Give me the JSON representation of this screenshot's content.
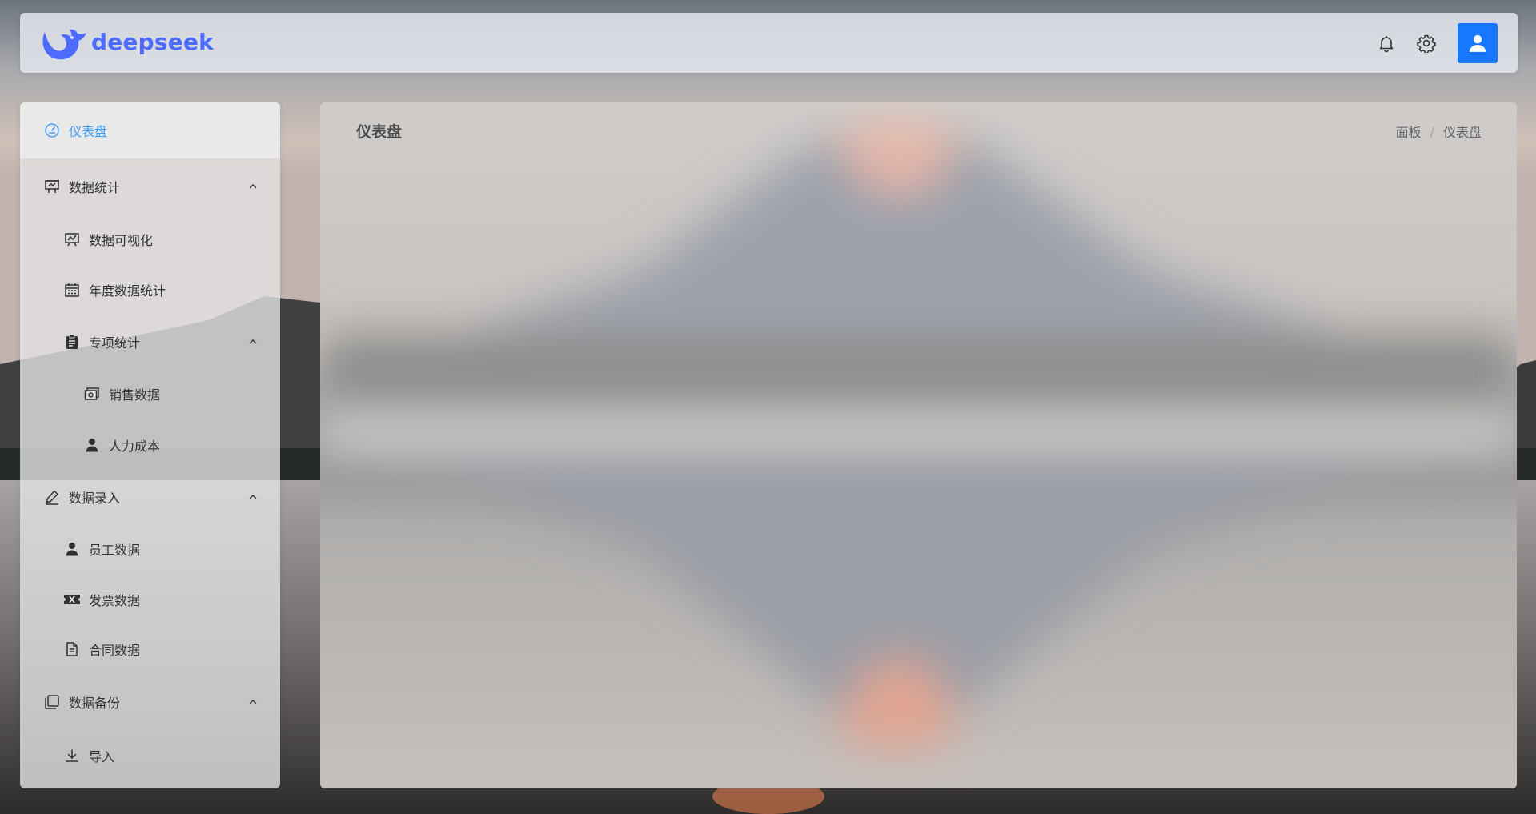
{
  "brand": {
    "name": "deepseek",
    "color": "#4d6bfe"
  },
  "header": {
    "icons": [
      "bell-icon",
      "gear-icon",
      "user-avatar-icon"
    ],
    "avatar_color": "#1677ff"
  },
  "sidebar": {
    "active_color": "#409eff",
    "items": [
      {
        "label": "仪表盘",
        "icon": "dashboard-icon",
        "active": true
      },
      {
        "label": "数据统计",
        "icon": "presentation-icon",
        "expanded": true
      },
      {
        "label": "数据可视化",
        "icon": "chart-board-icon"
      },
      {
        "label": "年度数据统计",
        "icon": "calendar-icon"
      },
      {
        "label": "专项统计",
        "icon": "clipboard-icon",
        "expanded": true
      },
      {
        "label": "销售数据",
        "icon": "sales-icon"
      },
      {
        "label": "人力成本",
        "icon": "user-icon"
      },
      {
        "label": "数据录入",
        "icon": "edit-icon",
        "expanded": true
      },
      {
        "label": "员工数据",
        "icon": "user-icon"
      },
      {
        "label": "发票数据",
        "icon": "ticket-icon"
      },
      {
        "label": "合同数据",
        "icon": "document-icon"
      },
      {
        "label": "数据备份",
        "icon": "copy-icon",
        "expanded": true
      },
      {
        "label": "导入",
        "icon": "download-icon"
      }
    ]
  },
  "main": {
    "title": "仪表盘",
    "breadcrumb": [
      "面板",
      "仪表盘"
    ]
  }
}
